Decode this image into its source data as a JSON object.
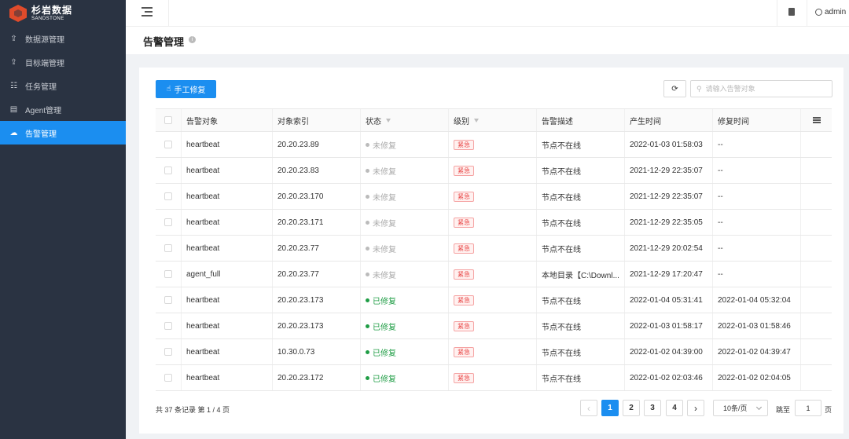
{
  "brand": {
    "name_cn": "杉岩数据",
    "name_en": "SANDSTONE"
  },
  "sidebar": {
    "items": [
      {
        "label": "数据源管理",
        "icon": "upload-icon"
      },
      {
        "label": "目标端管理",
        "icon": "upload-icon"
      },
      {
        "label": "任务管理",
        "icon": "tasks-icon"
      },
      {
        "label": "Agent管理",
        "icon": "agent-icon"
      },
      {
        "label": "告警管理",
        "icon": "alarm-icon",
        "active": true
      }
    ]
  },
  "header": {
    "user": "admin"
  },
  "page": {
    "title": "告警管理"
  },
  "toolbar": {
    "repair_label": "手工修复",
    "search_placeholder": "请输入告警对象"
  },
  "table": {
    "columns": [
      "告警对象",
      "对象索引",
      "状态",
      "级别",
      "告警描述",
      "产生时间",
      "修复时间"
    ],
    "rows": [
      {
        "target": "heartbeat",
        "index": "20.20.23.89",
        "status": "未修复",
        "fixed": false,
        "level": "紧急",
        "desc": "节点不在线",
        "created": "2022-01-03 01:58:03",
        "repaired": "--"
      },
      {
        "target": "heartbeat",
        "index": "20.20.23.83",
        "status": "未修复",
        "fixed": false,
        "level": "紧急",
        "desc": "节点不在线",
        "created": "2021-12-29 22:35:07",
        "repaired": "--"
      },
      {
        "target": "heartbeat",
        "index": "20.20.23.170",
        "status": "未修复",
        "fixed": false,
        "level": "紧急",
        "desc": "节点不在线",
        "created": "2021-12-29 22:35:07",
        "repaired": "--"
      },
      {
        "target": "heartbeat",
        "index": "20.20.23.171",
        "status": "未修复",
        "fixed": false,
        "level": "紧急",
        "desc": "节点不在线",
        "created": "2021-12-29 22:35:05",
        "repaired": "--"
      },
      {
        "target": "heartbeat",
        "index": "20.20.23.77",
        "status": "未修复",
        "fixed": false,
        "level": "紧急",
        "desc": "节点不在线",
        "created": "2021-12-29 20:02:54",
        "repaired": "--"
      },
      {
        "target": "agent_full",
        "index": "20.20.23.77",
        "status": "未修复",
        "fixed": false,
        "level": "紧急",
        "desc": "本地目录【C:\\Downl...",
        "created": "2021-12-29 17:20:47",
        "repaired": "--"
      },
      {
        "target": "heartbeat",
        "index": "20.20.23.173",
        "status": "已修复",
        "fixed": true,
        "level": "紧急",
        "desc": "节点不在线",
        "created": "2022-01-04 05:31:41",
        "repaired": "2022-01-04 05:32:04"
      },
      {
        "target": "heartbeat",
        "index": "20.20.23.173",
        "status": "已修复",
        "fixed": true,
        "level": "紧急",
        "desc": "节点不在线",
        "created": "2022-01-03 01:58:17",
        "repaired": "2022-01-03 01:58:46"
      },
      {
        "target": "heartbeat",
        "index": "10.30.0.73",
        "status": "已修复",
        "fixed": true,
        "level": "紧急",
        "desc": "节点不在线",
        "created": "2022-01-02 04:39:00",
        "repaired": "2022-01-02 04:39:47"
      },
      {
        "target": "heartbeat",
        "index": "20.20.23.172",
        "status": "已修复",
        "fixed": true,
        "level": "紧急",
        "desc": "节点不在线",
        "created": "2022-01-02 02:03:46",
        "repaired": "2022-01-02 02:04:05"
      }
    ]
  },
  "pagination": {
    "summary": "共 37 条记录 第 1 / 4 页",
    "pages": [
      "1",
      "2",
      "3",
      "4"
    ],
    "current": "1",
    "page_size": "10条/页",
    "jump_label": "跳至",
    "jump_value": "1",
    "page_unit": "页"
  },
  "colors": {
    "primary": "#1b8ef0",
    "sidebar_bg": "#2a3342",
    "danger": "#e84545",
    "success": "#1f9d45"
  }
}
